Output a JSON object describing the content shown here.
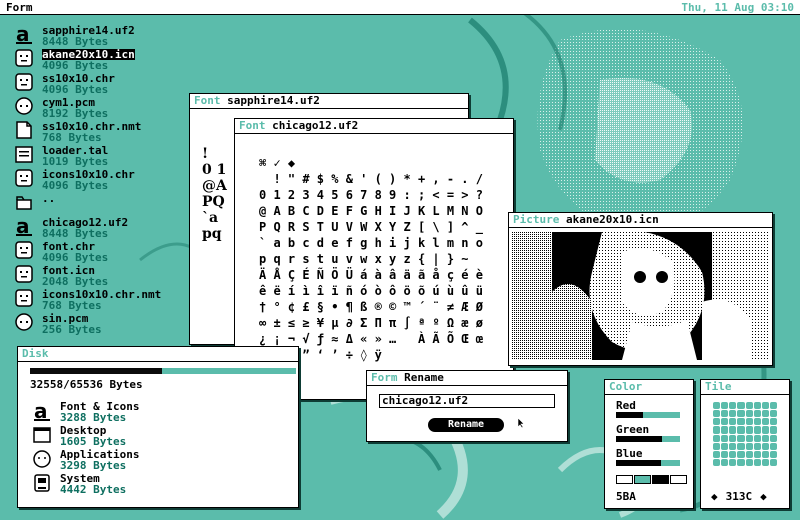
{
  "menubar": {
    "app_name": "Form",
    "clock": "Thu, 11 Aug 03:10"
  },
  "files": [
    {
      "name": "sapphire14.uf2",
      "size": "8448 Bytes",
      "icon": "font-file-icon",
      "selected": false
    },
    {
      "name": "akane20x10.icn",
      "size": "4096 Bytes",
      "icon": "image-file-icon",
      "selected": true
    },
    {
      "name": "ss10x10.chr",
      "size": "4096 Bytes",
      "icon": "image-file-icon",
      "selected": false
    },
    {
      "name": "cym1.pcm",
      "size": "8192 Bytes",
      "icon": "audio-file-icon",
      "selected": false
    },
    {
      "name": "ss10x10.chr.nmt",
      "size": "768 Bytes",
      "icon": "document-file-icon",
      "selected": false
    },
    {
      "name": "loader.tal",
      "size": "1019 Bytes",
      "icon": "text-file-icon",
      "selected": false
    },
    {
      "name": "icons10x10.chr",
      "size": "4096 Bytes",
      "icon": "image-file-icon",
      "selected": false
    },
    {
      "name": "..",
      "size": "",
      "icon": "parent-folder-icon",
      "selected": false
    },
    {
      "name": "chicago12.uf2",
      "size": "8448 Bytes",
      "icon": "font-file-icon",
      "selected": false
    },
    {
      "name": "font.chr",
      "size": "4096 Bytes",
      "icon": "image-file-icon",
      "selected": false
    },
    {
      "name": "font.icn",
      "size": "2048 Bytes",
      "icon": "image-file-icon",
      "selected": false
    },
    {
      "name": "icons10x10.chr.nmt",
      "size": "768 Bytes",
      "icon": "image-file-icon",
      "selected": false
    },
    {
      "name": "sin.pcm",
      "size": "256 Bytes",
      "icon": "audio-file-icon",
      "selected": false
    }
  ],
  "font_window_back": {
    "kind": "Font",
    "name": "sapphire14.uf2",
    "glyph_rows": [
      "!",
      "0 1",
      "@A",
      "PQ",
      "`a",
      "pq"
    ]
  },
  "font_window_front": {
    "kind": "Font",
    "name": "chicago12.uf2",
    "glyph_rows": [
      "⌘ ✓ ◆ ",
      "  ! \" # $ % & ' ( ) * + , - . /",
      "0 1 2 3 4 5 6 7 8 9 : ; < = > ?",
      "@ A B C D E F G H I J K L M N O",
      "P Q R S T U V W X Y Z [ \\ ] ^ _",
      "` a b c d e f g h i j k l m n o",
      "p q r s t u v w x y z { | } ~  ",
      "Ä Å Ç É Ñ Ö Ü á à â ä ã å ç é è",
      "ê ë í ì î ï ñ ó ò ô ö õ ú ù û ü",
      "† ° ¢ £ § • ¶ ß ® © ™ ´ ¨ ≠ Æ Ø",
      "∞ ± ≤ ≥ ¥ µ ∂ Σ Π π ∫ ª º Ω æ ø",
      "¿ ¡ ¬ √ ƒ ≈ Δ « » …   À Ã Õ Œ œ",
      "– — “ ” ‘ ’ ÷ ◊ ÿ"
    ]
  },
  "picture_window": {
    "kind": "Picture",
    "name": "akane20x10.icn"
  },
  "rename_window": {
    "kind": "Form",
    "name": "Rename",
    "field_value": "chicago12.uf2",
    "button_label": "Rename"
  },
  "disk_window": {
    "title": "Disk",
    "usage_text": "32558/65536 Bytes",
    "used_fraction": 0.497,
    "categories": [
      {
        "label": "Font & Icons",
        "size": "3288 Bytes",
        "icon": "font-category-icon"
      },
      {
        "label": "Desktop",
        "size": "1605 Bytes",
        "icon": "desktop-window-icon"
      },
      {
        "label": "Applications",
        "size": "3298 Bytes",
        "icon": "applications-icon"
      },
      {
        "label": "System",
        "size": "4442 Bytes",
        "icon": "system-drive-icon"
      }
    ]
  },
  "color_window": {
    "title": "Color",
    "channels": [
      {
        "label": "Red",
        "value": 0.42
      },
      {
        "label": "Green",
        "value": 0.72
      },
      {
        "label": "Blue",
        "value": 0.7
      }
    ],
    "swatches": [
      "#ffffff",
      "#5bbcab",
      "#000000",
      "#ffffff"
    ],
    "hex_text": "5BA"
  },
  "tile_window": {
    "title": "Tile",
    "value_text": "313C"
  },
  "colors": {
    "teal": "#5bbcab",
    "dark_teal": "#0e6f60",
    "black": "#000000",
    "white": "#ffffff"
  }
}
